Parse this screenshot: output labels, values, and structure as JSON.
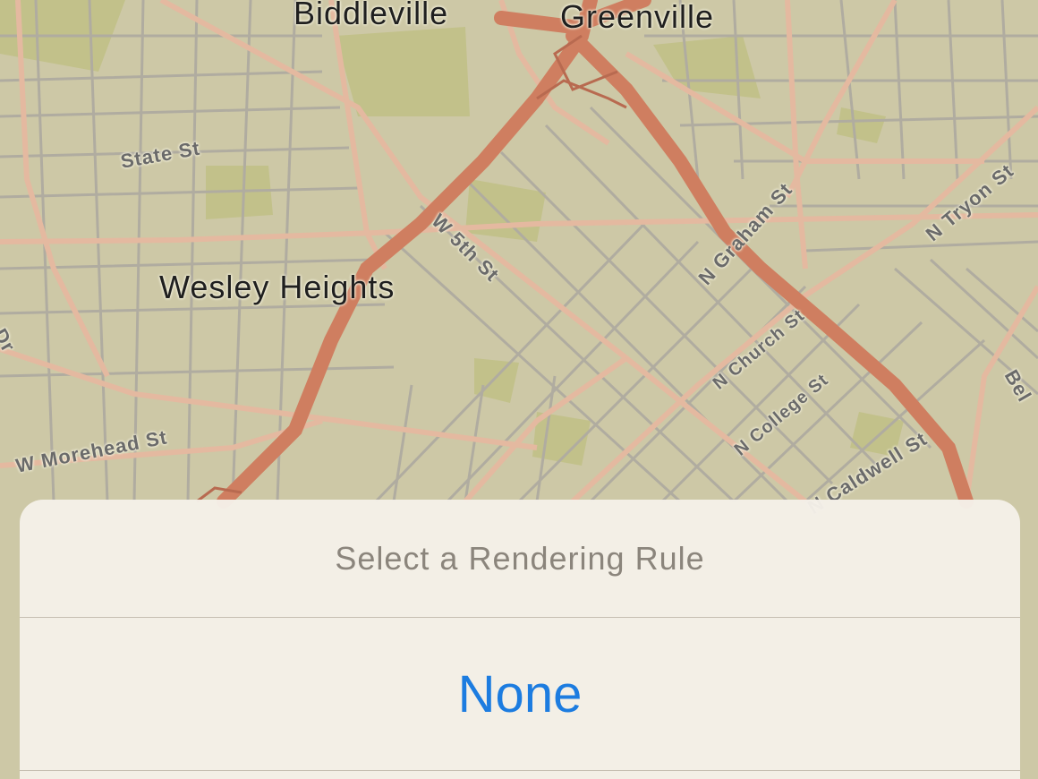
{
  "map": {
    "places": [
      "Biddleville",
      "Greenville",
      "Wesley Heights"
    ],
    "streets": [
      "State St",
      "W 5th St",
      "N Graham St",
      "N Tryon St",
      "N Church St",
      "N College St",
      "N Caldwell St",
      "W Morehead St",
      "Bel",
      "Dr"
    ],
    "colors": {
      "land": "#cdc8a6",
      "park": "#c2c18a",
      "road": "#e4b9a0",
      "street": "#b0aca0",
      "highway": "#cf7e60"
    }
  },
  "sheet": {
    "title": "Select a Rendering Rule",
    "options": [
      "None"
    ],
    "colors": {
      "title": "#8b857c",
      "option": "#1c7ce0"
    }
  }
}
